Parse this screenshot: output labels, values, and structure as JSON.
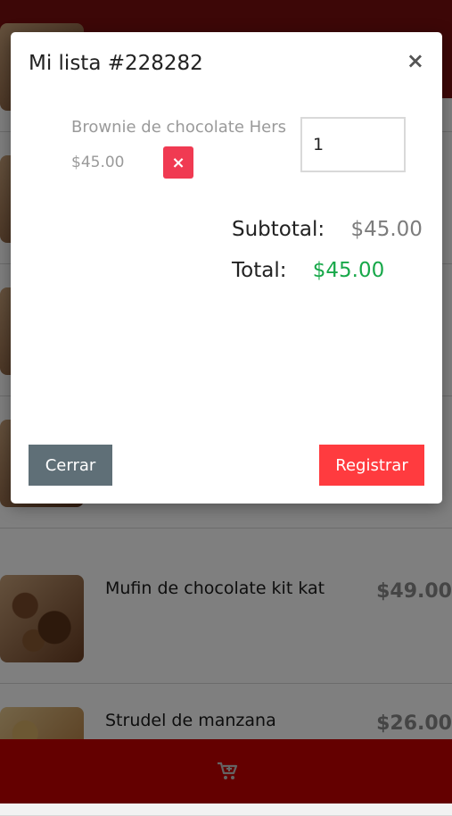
{
  "modal": {
    "title": "Mi lista #228282",
    "close_icon": "×",
    "item": {
      "name": "Brownie de chocolate Hers",
      "price": "$45.00",
      "remove_icon": "×",
      "quantity": "1"
    },
    "subtotal_label": "Subtotal:",
    "subtotal_value": "$45.00",
    "total_label": "Total:",
    "total_value": "$45.00",
    "close_button": "Cerrar",
    "register_button": "Registrar"
  },
  "products": [
    {
      "name": "Mufin de chocolate kit kat",
      "price": "$49.00"
    },
    {
      "name": "Strudel de manzana",
      "price": "$26.00"
    }
  ],
  "colors": {
    "topbar": "#7a0f0f",
    "bottombar": "#c80000",
    "register": "#ff3b3f",
    "close": "#5f6f77",
    "total": "#18a84a",
    "remove": "#f03a52"
  },
  "icons": {
    "cart": "cart-plus-icon"
  }
}
